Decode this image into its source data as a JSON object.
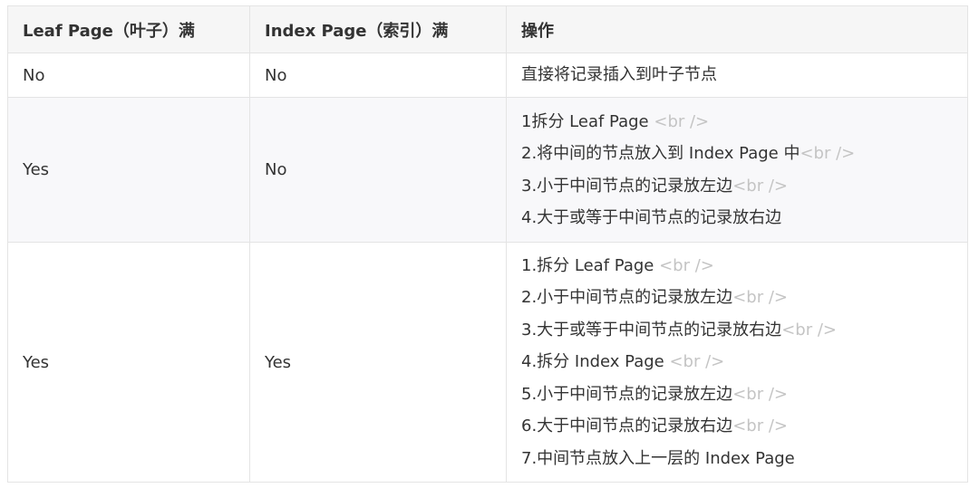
{
  "headers": [
    "Leaf Page（叶子）满",
    "Index Page（索引）满",
    "操作"
  ],
  "br_tag": "<br />",
  "rows": [
    {
      "leaf": "No",
      "index": "No",
      "ops": [
        {
          "text": "直接将记录插入到叶子节点",
          "br": false
        }
      ]
    },
    {
      "leaf": "Yes",
      "index": "No",
      "ops": [
        {
          "text": "1拆分 Leaf Page ",
          "br": true
        },
        {
          "text": "2.将中间的节点放入到 Index Page 中",
          "br": true
        },
        {
          "text": "3.小于中间节点的记录放左边",
          "br": true
        },
        {
          "text": "4.大于或等于中间节点的记录放右边",
          "br": false
        }
      ]
    },
    {
      "leaf": "Yes",
      "index": "Yes",
      "ops": [
        {
          "text": "1.拆分 Leaf Page ",
          "br": true
        },
        {
          "text": "2.小于中间节点的记录放左边",
          "br": true
        },
        {
          "text": "3.大于或等于中间节点的记录放右边",
          "br": true
        },
        {
          "text": "4.拆分 Index Page ",
          "br": true
        },
        {
          "text": "5.小于中间节点的记录放左边",
          "br": true
        },
        {
          "text": "6.大于中间节点的记录放右边",
          "br": true
        },
        {
          "text": "7.中间节点放入上一层的 Index Page",
          "br": false
        }
      ]
    }
  ]
}
